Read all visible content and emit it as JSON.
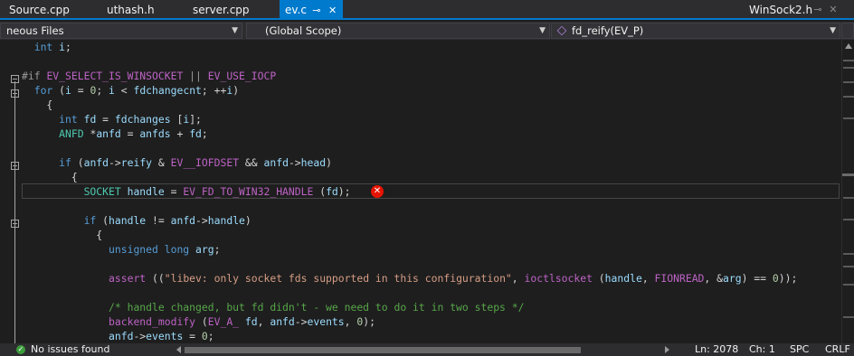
{
  "tabs": [
    {
      "label": "Source.cpp",
      "active": false
    },
    {
      "label": "uthash.h",
      "active": false
    },
    {
      "label": "server.cpp",
      "active": false
    },
    {
      "label": "ev.c",
      "active": true,
      "pin": "⊸",
      "close": "✕"
    }
  ],
  "right_tab": {
    "label": "WinSock2.h",
    "pin": "⊸",
    "close": "✕"
  },
  "nav": {
    "project": "neous Files",
    "scope": "(Global Scope)",
    "member": "fd_reify(EV_P)"
  },
  "code_lines": [
    [
      "  ",
      {
        "c": "kw",
        "t": "int"
      },
      " ",
      {
        "c": "var",
        "t": "i"
      },
      ";"
    ],
    [
      ""
    ],
    [
      {
        "c": "pp",
        "t": "#if "
      },
      {
        "c": "mac",
        "t": "EV_SELECT_IS_WINSOCKET"
      },
      {
        "c": "pp",
        "t": " || "
      },
      {
        "c": "mac",
        "t": "EV_USE_IOCP"
      }
    ],
    [
      "  ",
      {
        "c": "kw",
        "t": "for"
      },
      " (",
      {
        "c": "var",
        "t": "i"
      },
      " = ",
      {
        "c": "num",
        "t": "0"
      },
      "; ",
      {
        "c": "var",
        "t": "i"
      },
      " < ",
      {
        "c": "var",
        "t": "fdchangecnt"
      },
      "; ++",
      {
        "c": "var",
        "t": "i"
      },
      ")"
    ],
    [
      "    {"
    ],
    [
      "      ",
      {
        "c": "kw",
        "t": "int"
      },
      " ",
      {
        "c": "var",
        "t": "fd"
      },
      " = ",
      {
        "c": "var",
        "t": "fdchanges"
      },
      " [",
      {
        "c": "var",
        "t": "i"
      },
      "];"
    ],
    [
      "      ",
      {
        "c": "ty",
        "t": "ANFD"
      },
      " *",
      {
        "c": "var",
        "t": "anfd"
      },
      " = ",
      {
        "c": "var",
        "t": "anfds"
      },
      " + ",
      {
        "c": "var",
        "t": "fd"
      },
      ";"
    ],
    [
      ""
    ],
    [
      "      ",
      {
        "c": "kw",
        "t": "if"
      },
      " (",
      {
        "c": "var",
        "t": "anfd"
      },
      "->",
      {
        "c": "var",
        "t": "reify"
      },
      " & ",
      {
        "c": "mac",
        "t": "EV__IOFDSET"
      },
      " && ",
      {
        "c": "var",
        "t": "anfd"
      },
      "->",
      {
        "c": "var",
        "t": "head"
      },
      ")"
    ],
    [
      "        {"
    ],
    [
      "          ",
      {
        "c": "ty",
        "t": "SOCKET"
      },
      " ",
      {
        "c": "var",
        "t": "handle"
      },
      " = ",
      {
        "c": "mac",
        "t": "EV_FD_TO_WIN32_HANDLE"
      },
      " (",
      {
        "c": "var",
        "t": "fd"
      },
      ");"
    ],
    [
      ""
    ],
    [
      "          ",
      {
        "c": "kw",
        "t": "if"
      },
      " (",
      {
        "c": "var",
        "t": "handle"
      },
      " != ",
      {
        "c": "var",
        "t": "anfd"
      },
      "->",
      {
        "c": "var",
        "t": "handle"
      },
      ")"
    ],
    [
      "            {"
    ],
    [
      "              ",
      {
        "c": "kw",
        "t": "unsigned long"
      },
      " ",
      {
        "c": "var",
        "t": "arg"
      },
      ";"
    ],
    [
      ""
    ],
    [
      "              ",
      {
        "c": "mac",
        "t": "assert"
      },
      " ((",
      {
        "c": "str",
        "t": "\"libev: only socket fds supported in this configuration\""
      },
      ", ",
      {
        "c": "mac",
        "t": "ioctlsocket"
      },
      " (",
      {
        "c": "var",
        "t": "handle"
      },
      ", ",
      {
        "c": "mac",
        "t": "FIONREAD"
      },
      ", &",
      {
        "c": "var",
        "t": "arg"
      },
      ") == ",
      {
        "c": "num",
        "t": "0"
      },
      "));"
    ],
    [
      ""
    ],
    [
      "              ",
      {
        "c": "cm",
        "t": "/* handle changed, but fd didn't - we need to do it in two steps */"
      }
    ],
    [
      "              ",
      {
        "c": "mac",
        "t": "backend_modify"
      },
      " (",
      {
        "c": "mac",
        "t": "EV_A_"
      },
      " ",
      {
        "c": "var",
        "t": "fd"
      },
      ", ",
      {
        "c": "var",
        "t": "anfd"
      },
      "->",
      {
        "c": "var",
        "t": "events"
      },
      ", ",
      {
        "c": "num",
        "t": "0"
      },
      ");"
    ],
    [
      "              ",
      {
        "c": "var",
        "t": "anfd"
      },
      "->",
      {
        "c": "var",
        "t": "events"
      },
      " = ",
      {
        "c": "num",
        "t": "0"
      },
      ";"
    ]
  ],
  "error_icon": "error-icon",
  "status": {
    "issues": "No issues found",
    "line": "Ln: 2078",
    "col": "Ch: 1",
    "spc": "SPC",
    "eol": "CRLF"
  },
  "colors": {
    "accent": "#007acc",
    "error": "#e51400",
    "ok": "#3c9c3c"
  }
}
